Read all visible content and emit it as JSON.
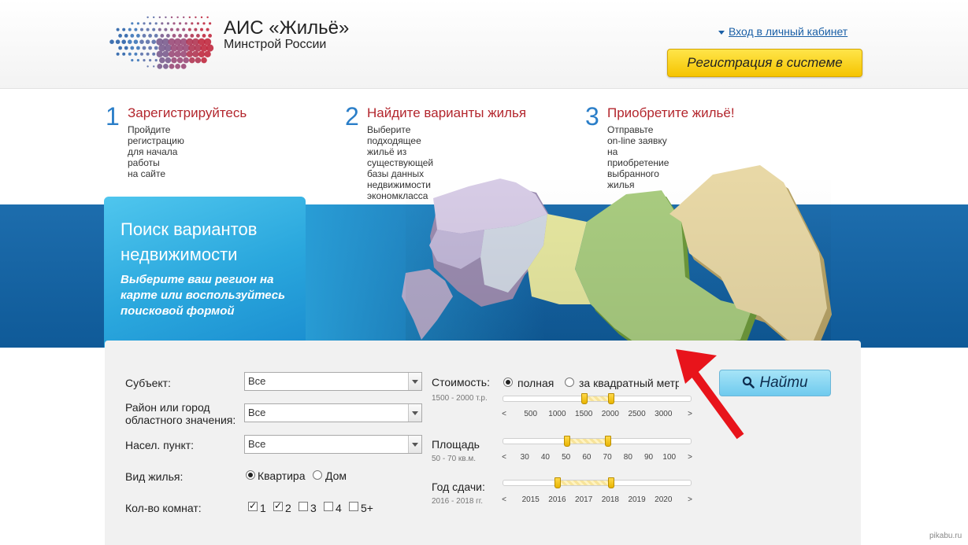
{
  "header": {
    "title": "АИС «Жильё»",
    "subtitle": "Минстрой России",
    "login_link": "Вход в личный кабинет",
    "register_button": "Регистрация в системе"
  },
  "steps": [
    {
      "num": "1",
      "title": "Зарегистрируйтесь",
      "desc_lines": [
        "Пройдите регистрацию для начала работы",
        "на сайте"
      ]
    },
    {
      "num": "2",
      "title": "Найдите варианты жилья",
      "desc_lines": [
        "Выберите подходящее жильё из",
        "существующей базы данных недвижимости",
        "экономкласса"
      ]
    },
    {
      "num": "3",
      "title": "Приобретите жильё!",
      "desc_lines": [
        "Отправьте on-line заявку на приобретение",
        "выбранного жилья"
      ]
    }
  ],
  "banner": {
    "title_lines": [
      "Поиск вариантов",
      "недвижимости"
    ],
    "subtitle_lines": [
      "Выберите ваш регион на",
      "карте или воспользуйтесь",
      "поисковой формой"
    ]
  },
  "form": {
    "subject_label": "Субъект:",
    "subject_value": "Все",
    "district_label_lines": [
      "Район или город",
      "областного значения:"
    ],
    "district_value": "Все",
    "settlement_label": "Насел. пункт:",
    "settlement_value": "Все",
    "housing_type_label": "Вид жилья:",
    "housing_types": [
      {
        "label": "Квартира",
        "selected": true
      },
      {
        "label": "Дом",
        "selected": false
      }
    ],
    "rooms_label": "Кол-во комнат:",
    "rooms": [
      {
        "label": "1",
        "checked": true
      },
      {
        "label": "2",
        "checked": true
      },
      {
        "label": "3",
        "checked": false
      },
      {
        "label": "4",
        "checked": false
      },
      {
        "label": "5+",
        "checked": false
      }
    ],
    "cost": {
      "label": "Стоимость:",
      "options": [
        {
          "label": "полная",
          "selected": true
        },
        {
          "label": "за квадратный метр",
          "selected": false
        }
      ],
      "range_text": "1500 - 2000 т.р.",
      "ticks": [
        "<",
        "500",
        "1000",
        "1500",
        "2000",
        "2500",
        "3000",
        ">"
      ],
      "range": [
        1500,
        2000
      ]
    },
    "area": {
      "label": "Площадь",
      "range_text": "50 - 70 кв.м.",
      "ticks": [
        "<",
        "30",
        "40",
        "50",
        "60",
        "70",
        "80",
        "90",
        "100",
        ">"
      ],
      "range": [
        50,
        70
      ]
    },
    "year": {
      "label": "Год сдачи:",
      "range_text": "2016 - 2018 гг.",
      "ticks": [
        "<",
        "2015",
        "2016",
        "2017",
        "2018",
        "2019",
        "2020",
        ">"
      ],
      "range": [
        2016,
        2018
      ]
    },
    "search_button": "Найти"
  },
  "watermark": "pikabu.ru",
  "colors": {
    "accent_blue": "#2a7ec8",
    "step_title_red": "#b3262d",
    "register_yellow": "#f5c400",
    "banner_blue": "#1a6aab",
    "arrow_red": "#e8141b"
  }
}
